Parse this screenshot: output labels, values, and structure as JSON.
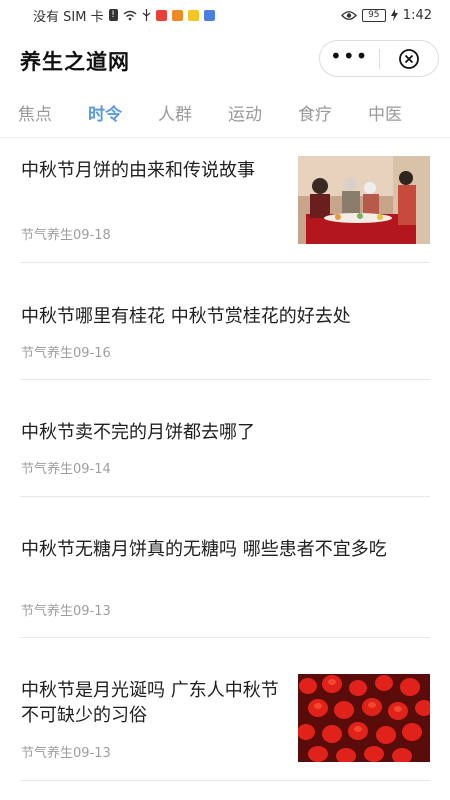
{
  "status_bar": {
    "carrier": "没有 SIM 卡",
    "battery": "95",
    "time": "1:42"
  },
  "header": {
    "title": "养生之道网",
    "more_label": "•••"
  },
  "tabs": [
    "焦点",
    "时令",
    "人群",
    "运动",
    "食疗",
    "中医"
  ],
  "active_tab": 1,
  "articles": [
    {
      "title": "中秋节月饼的由来和传说故事",
      "meta": "节气养生09-18",
      "thumbnail": "family-dinner-image"
    },
    {
      "title": "中秋节哪里有桂花 中秋节赏桂花的好去处",
      "meta": "节气养生09-16"
    },
    {
      "title": "中秋节卖不完的月饼都去哪了",
      "meta": "节气养生09-14"
    },
    {
      "title": "中秋节无糖月饼真的无糖吗 哪些患者不宜多吃",
      "meta": "节气养生09-13"
    },
    {
      "title": "中秋节是月光诞吗 广东人中秋节不可缺少的习俗",
      "meta": "节气养生09-13",
      "thumbnail": "red-lanterns-image"
    }
  ],
  "colors": {
    "accent": "#5c9bd9",
    "muted": "#9e9e9e"
  }
}
